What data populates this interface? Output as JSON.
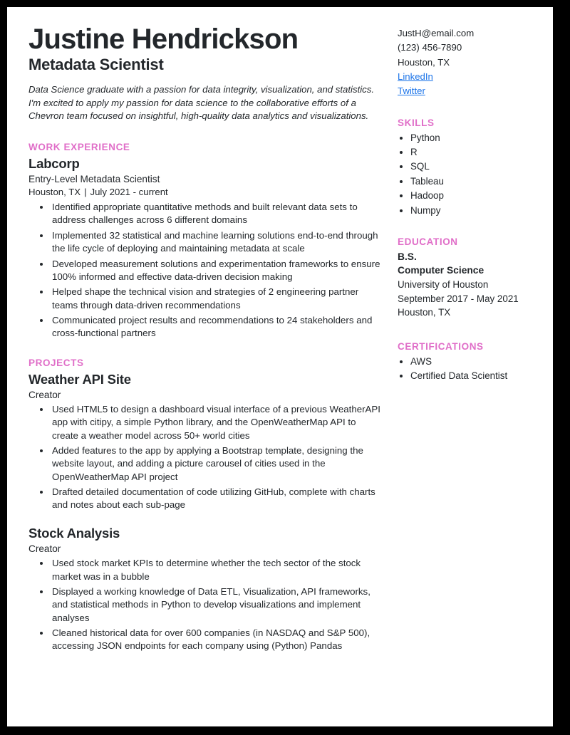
{
  "header": {
    "name": "Justine Hendrickson",
    "job_title": "Metadata Scientist",
    "summary": "Data Science graduate with a passion for data integrity, visualization, and statistics. I'm excited to apply my passion for data science to the collaborative efforts of a Chevron team focused on insightful, high-quality data analytics and visualizations."
  },
  "contact": {
    "email": "JustH@email.com",
    "phone": "(123) 456-7890",
    "location": "Houston, TX",
    "linkedin_label": "LinkedIn",
    "twitter_label": "Twitter"
  },
  "sections": {
    "work_experience_heading": "WORK EXPERIENCE",
    "projects_heading": "PROJECTS",
    "skills_heading": "SKILLS",
    "education_heading": "EDUCATION",
    "certifications_heading": "CERTIFICATIONS"
  },
  "work_experience": [
    {
      "organization": "Labcorp",
      "role": "Entry-Level Metadata Scientist",
      "location": "Houston, TX",
      "separator": "|",
      "dates": "July 2021 - current",
      "bullets": [
        "Identified appropriate quantitative methods and built relevant data sets to address challenges across 6 different domains",
        "Implemented 32 statistical and machine learning solutions end-to-end through the life cycle of deploying and maintaining metadata at scale",
        "Developed measurement solutions and experimentation frameworks to ensure 100% informed and effective data-driven decision making",
        "Helped shape the technical vision and strategies of 2 engineering partner teams through data-driven recommendations",
        "Communicated project results and recommendations to 24 stakeholders and cross-functional partners"
      ]
    }
  ],
  "projects": [
    {
      "organization": "Weather API Site",
      "role": "Creator",
      "bullets": [
        "Used HTML5 to design a dashboard visual interface of a previous WeatherAPI app with citipy, a simple Python library, and the OpenWeatherMap API to create a weather model across 50+ world cities",
        "Added features to the app by applying a Bootstrap template, designing the website layout, and adding a picture carousel of cities used in the OpenWeatherMap API project",
        "Drafted detailed documentation of code utilizing GitHub, complete with charts and notes about each sub-page"
      ]
    },
    {
      "organization": "Stock Analysis",
      "role": "Creator",
      "bullets": [
        "Used stock market KPIs to determine whether the tech sector of the stock market was in a bubble",
        "Displayed a working knowledge of Data ETL, Visualization, API frameworks, and statistical methods in Python to develop visualizations and implement analyses",
        "Cleaned historical data for over 600 companies (in NASDAQ and S&P 500), accessing JSON endpoints for each company using (Python) Pandas"
      ]
    }
  ],
  "skills": [
    "Python",
    "R",
    "SQL",
    "Tableau",
    "Hadoop",
    "Numpy"
  ],
  "education": {
    "degree": "B.S.",
    "major": "Computer Science",
    "school": "University of Houston",
    "dates": "September 2017 - May 2021",
    "location": "Houston, TX"
  },
  "certifications": [
    "AWS",
    "Certified Data Scientist"
  ],
  "colors": {
    "accent": "#e06ec8",
    "text": "#23272b",
    "link": "#1a73e8",
    "page_border": "#000000"
  }
}
